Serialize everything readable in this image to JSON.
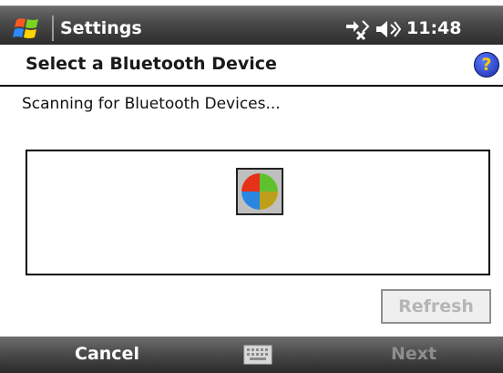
{
  "statusbar": {
    "app_title": "Settings",
    "clock": "11:48"
  },
  "header": {
    "title": "Select a Bluetooth Device"
  },
  "main": {
    "status_text": "Scanning for Bluetooth Devices..."
  },
  "buttons": {
    "refresh": "Refresh"
  },
  "softkeys": {
    "left": "Cancel",
    "right": "Next"
  },
  "colors": {
    "title_bar": "#4a4a4a",
    "help_icon": "#1a2ba8",
    "disabled_text": "#b5b5b5"
  },
  "icons": [
    "windows-start-icon",
    "connectivity-icon",
    "volume-icon",
    "help-icon",
    "scanning-icon",
    "keyboard-icon"
  ]
}
